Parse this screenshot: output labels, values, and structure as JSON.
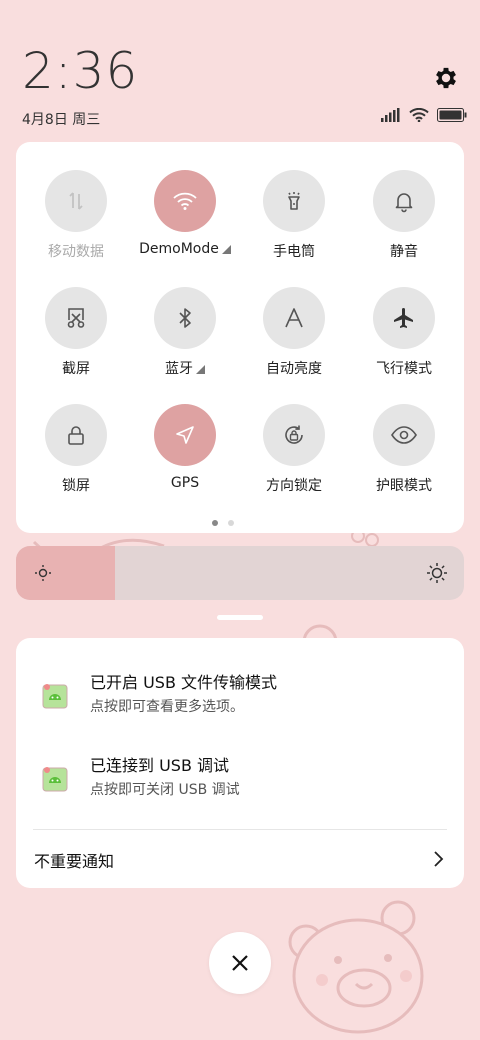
{
  "status": {
    "time": "2:36",
    "date": "4月8日 周三",
    "icons": [
      "signal-icon",
      "wifi-icon",
      "battery-icon"
    ]
  },
  "settings_icon": "gear-icon",
  "quick_settings": {
    "tiles": [
      {
        "label": "移动数据",
        "icon": "mobile-data-icon",
        "active": false,
        "disabled": true
      },
      {
        "label": "DemoMode",
        "icon": "wifi-icon",
        "active": true,
        "has_submenu": true
      },
      {
        "label": "手电筒",
        "icon": "flashlight-icon",
        "active": false
      },
      {
        "label": "静音",
        "icon": "bell-icon",
        "active": false
      },
      {
        "label": "截屏",
        "icon": "screenshot-icon",
        "active": false
      },
      {
        "label": "蓝牙",
        "icon": "bluetooth-icon",
        "active": false,
        "has_submenu": true
      },
      {
        "label": "自动亮度",
        "icon": "auto-brightness-icon",
        "active": false
      },
      {
        "label": "飞行模式",
        "icon": "airplane-icon",
        "active": false
      },
      {
        "label": "锁屏",
        "icon": "lock-icon",
        "active": false
      },
      {
        "label": "GPS",
        "icon": "gps-icon",
        "active": true
      },
      {
        "label": "方向锁定",
        "icon": "rotation-lock-icon",
        "active": false
      },
      {
        "label": "护眼模式",
        "icon": "eye-icon",
        "active": false
      }
    ],
    "pages": 2,
    "current_page": 1
  },
  "brightness": {
    "level": 0.22
  },
  "notifications": [
    {
      "title": "已开启 USB 文件传输模式",
      "body": "点按即可查看更多选项。",
      "icon": "android-debug-icon"
    },
    {
      "title": "已连接到 USB 调试",
      "body": "点按即可关闭 USB 调试",
      "icon": "android-debug-icon"
    }
  ],
  "unimportant_label": "不重要通知",
  "colors": {
    "active_tile": "#dea2a2",
    "inactive_tile": "#e5e5e5",
    "background": "#f9dede",
    "brightness_fill": "#e8b2b2"
  }
}
